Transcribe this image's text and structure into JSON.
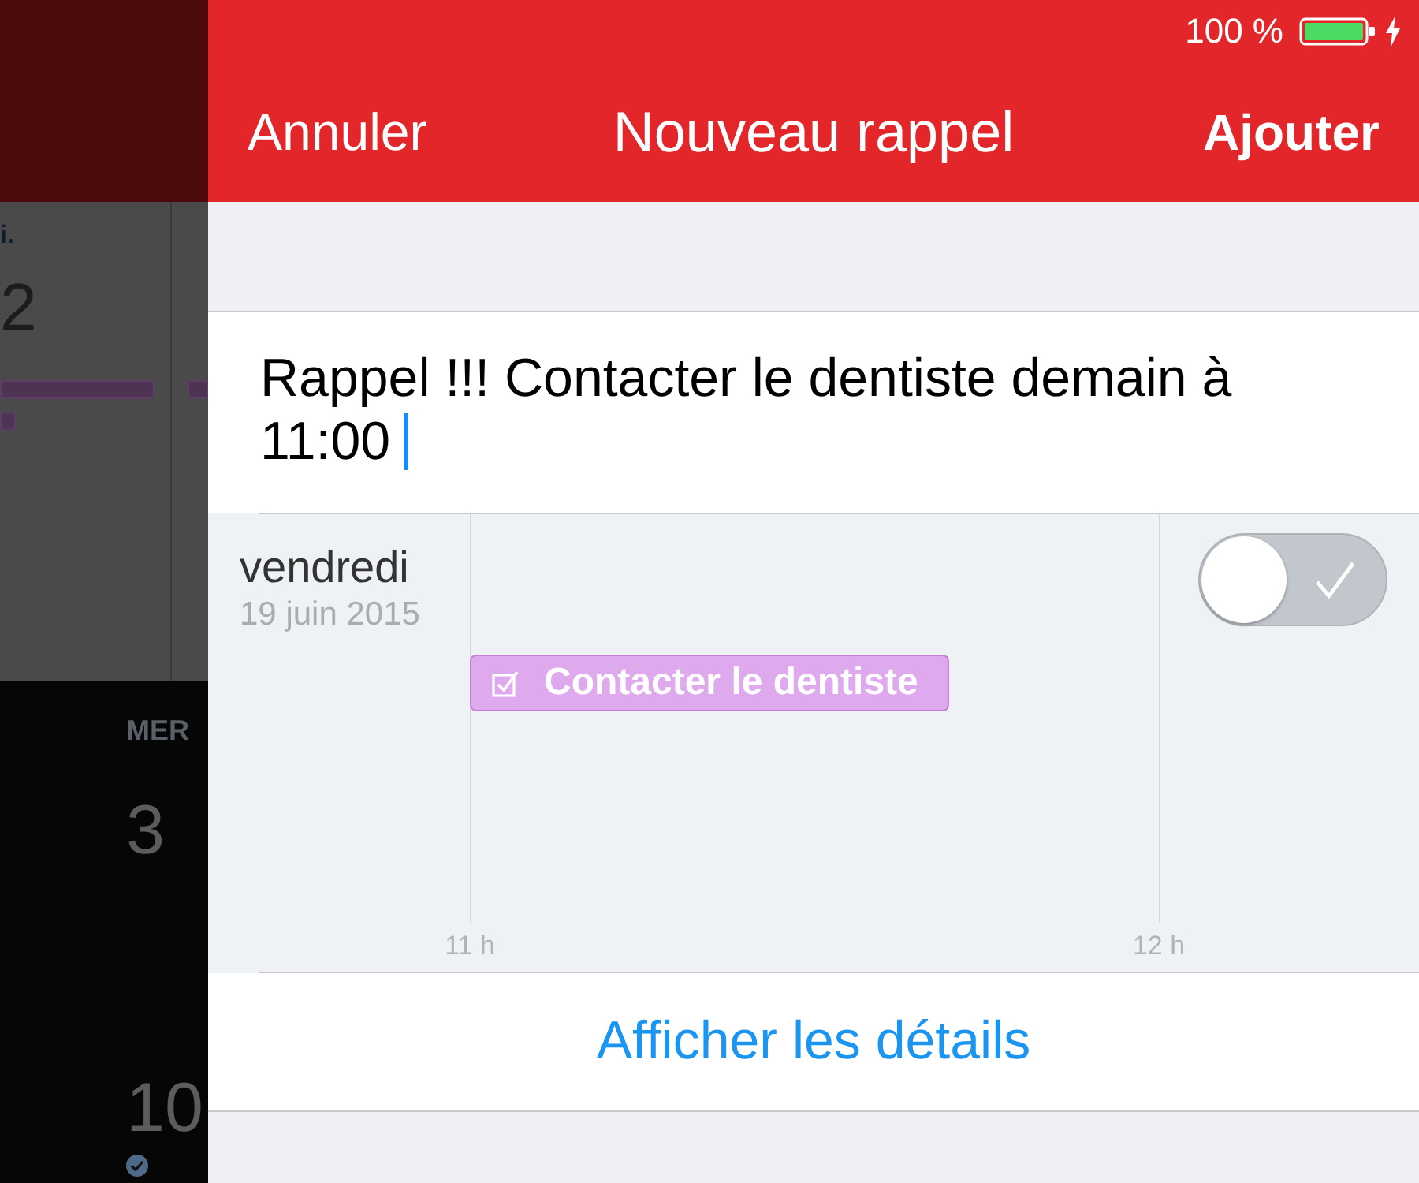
{
  "background_calendar": {
    "upper_weekday": "i.",
    "upper_day": "2",
    "lower_weekday": "MER",
    "lower_days": [
      "3",
      "10"
    ]
  },
  "status_bar": {
    "battery": "100 %"
  },
  "nav_bar": {
    "cancel": "Annuler",
    "title": "Nouveau rappel",
    "add": "Ajouter"
  },
  "reminder_field": {
    "value": "Rappel !!! Contacter le dentiste demain à 11:00"
  },
  "day_preview": {
    "weekday": "vendredi",
    "date": "19 juin 2015",
    "hours": [
      "11 h",
      "12 h"
    ],
    "event": {
      "title": "Contacter le dentiste",
      "color": "#dfa9ee"
    },
    "toggle": {
      "on": false
    }
  },
  "details_link": "Afficher les détails"
}
